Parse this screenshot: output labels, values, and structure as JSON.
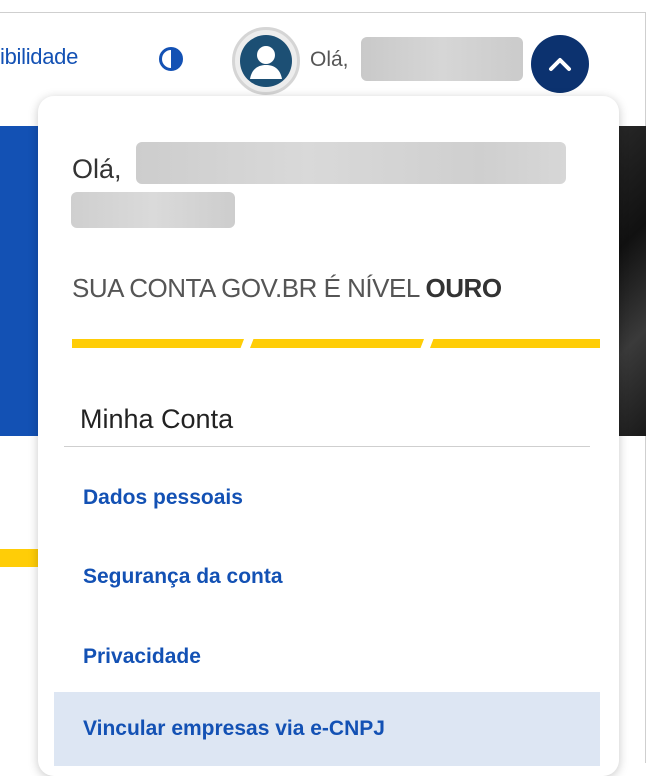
{
  "header": {
    "accessibility_label": "ibilidade",
    "contrast_icon": "contrast-icon",
    "avatar_icon": "user-avatar-icon",
    "greeting": "Olá,",
    "toggle_icon": "chevron-up-icon"
  },
  "menu": {
    "greeting": "Olá,",
    "level_prefix": "SUA CONTA GOV.BR É NÍVEL ",
    "level_value": "OURO",
    "section_title": "Minha Conta",
    "items": [
      {
        "label": "Dados pessoais"
      },
      {
        "label": "Segurança da conta"
      },
      {
        "label": "Privacidade"
      },
      {
        "label": "Vincular empresas via e-CNPJ"
      }
    ]
  },
  "colors": {
    "primary_blue": "#1351b4",
    "dark_blue": "#0c326f",
    "gold": "#ffcd07",
    "highlight": "#dde6f3"
  }
}
